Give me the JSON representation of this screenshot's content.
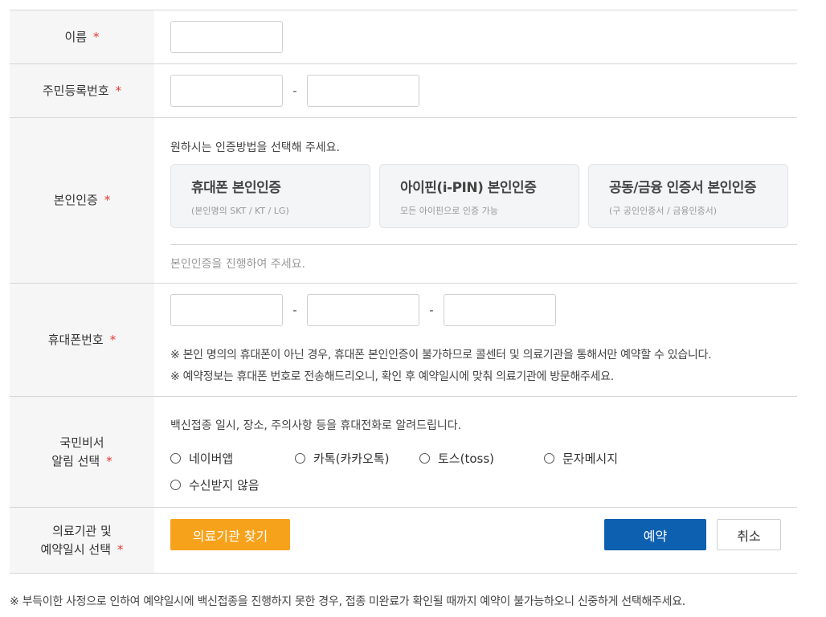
{
  "required_mark": "*",
  "dash": "-",
  "name_row": {
    "label": "이름"
  },
  "rrn_row": {
    "label": "주민등록번호"
  },
  "auth_row": {
    "label": "본인인증",
    "description": "원하시는 인증방법을 선택해 주세요.",
    "methods": [
      {
        "title": "휴대폰 본인인증",
        "subtitle": "(본인명의 SKT / KT / LG)"
      },
      {
        "title": "아이핀(i-PIN) 본인인증",
        "subtitle": "모든 아이핀으로 인증 가능"
      },
      {
        "title": "공동/금융 인증서 본인인증",
        "subtitle": "(구 공인인증서 / 금융인증서)"
      }
    ],
    "status": "본인인증을 진행하여 주세요."
  },
  "phone_row": {
    "label": "휴대폰번호",
    "notes": [
      "※ 본인 명의의 휴대폰이 아닌 경우, 휴대폰 본인인증이 불가하므로 콜센터 및 의료기관을 통해서만 예약할 수 있습니다.",
      "※ 예약정보는 휴대폰 번호로 전송해드리오니, 확인 후 예약일시에 맞춰 의료기관에 방문해주세요."
    ]
  },
  "notice_row": {
    "label_line1": "국민비서",
    "label_line2": "알림 선택",
    "description": "백신접종 일시, 장소, 주의사항 등을 휴대전화로 알려드립니다.",
    "options": [
      "네이버앱",
      "카톡(카카오톡)",
      "토스(toss)",
      "문자메시지",
      "수신받지 않음"
    ]
  },
  "hospital_row": {
    "label_line1": "의료기관 및",
    "label_line2": "예약일시 선택",
    "find_button": "의료기관 찾기",
    "reserve_button": "예약",
    "cancel_button": "취소"
  },
  "bottom_note": "※ 부득이한 사정으로 인하여 예약일시에 백신접종을 진행하지 못한 경우, 접종 미완료가 확인될 때까지 예약이 불가능하오니 신중하게 선택해주세요.",
  "colors": {
    "required": "#e53935",
    "find_button": "#f7a21b",
    "reserve_button": "#0d5fb0",
    "label_background": "#f6f6f6"
  }
}
